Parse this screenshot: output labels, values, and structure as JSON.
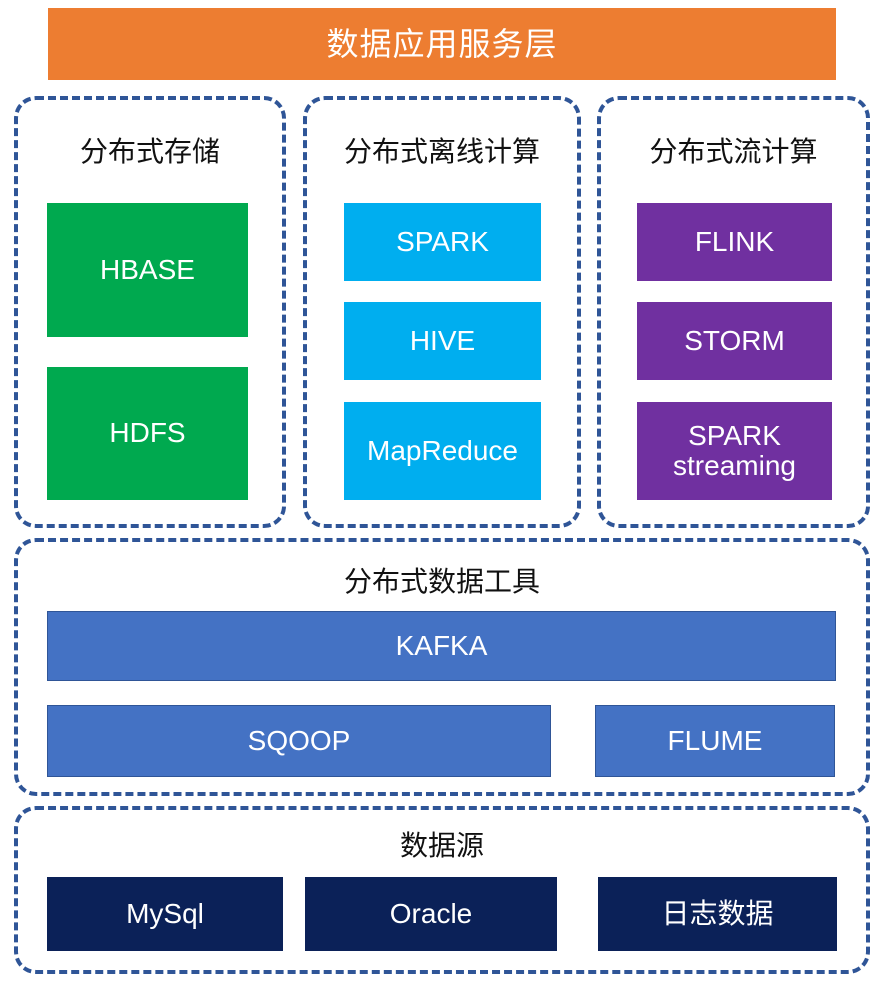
{
  "banner": {
    "label": "数据应用服务层",
    "color": "#ED7D31"
  },
  "panels": [
    {
      "id": "distributed-storage",
      "title": "分布式存储",
      "color": "#00A94F",
      "items": [
        {
          "label": "HBASE"
        },
        {
          "label": "HDFS"
        }
      ]
    },
    {
      "id": "distributed-offline-compute",
      "title": "分布式离线计算",
      "color": "#00AEEF",
      "items": [
        {
          "label": "SPARK"
        },
        {
          "label": "HIVE"
        },
        {
          "label": "MapReduce"
        }
      ]
    },
    {
      "id": "distributed-stream-compute",
      "title": "分布式流计算",
      "color": "#7030A0",
      "items": [
        {
          "label": "FLINK"
        },
        {
          "label": "STORM"
        },
        {
          "label_line1": "SPARK",
          "label_line2": "streaming"
        }
      ]
    },
    {
      "id": "distributed-data-tools",
      "title": "分布式数据工具",
      "color": "#4472C4",
      "items": [
        {
          "label": "KAFKA"
        },
        {
          "label": "SQOOP"
        },
        {
          "label": "FLUME"
        }
      ]
    },
    {
      "id": "data-source",
      "title": "数据源",
      "color": "#0B2158",
      "items": [
        {
          "label": "MySql"
        },
        {
          "label": "Oracle"
        },
        {
          "label": "日志数据"
        }
      ]
    }
  ],
  "theme": {
    "panel_border": "#2F5597",
    "tile_text": "#ffffff",
    "title_text": "#111111",
    "background": "#ffffff"
  }
}
